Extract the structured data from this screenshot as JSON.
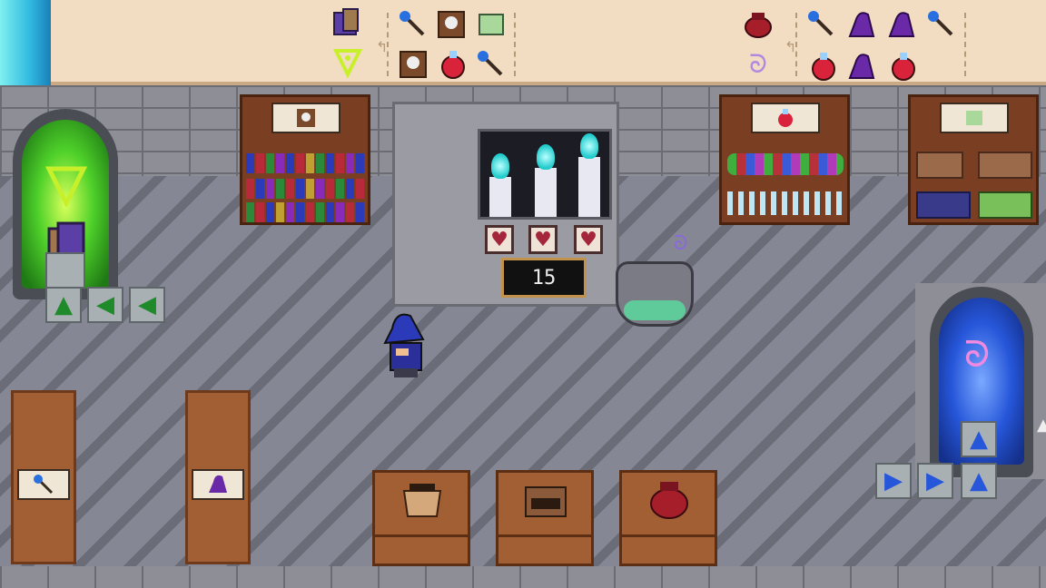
{
  "hud": {
    "timer_value": "15"
  },
  "colors": {
    "topbar_bg": "#f2ddc2",
    "portal_green": "#4fd12a",
    "portal_blue": "#2656d9",
    "flame_cyan": "#7ff0f0",
    "wood": "#a35f34"
  },
  "recipes": [
    {
      "result_icon": "blue-cube-icon",
      "result_mark": "green-triangle-rune-icon",
      "ingredients": [
        "blue-wand-icon",
        "skull-book-icon",
        "green-scroll-icon",
        "skull-book-icon",
        "red-potion-icon",
        "blue-wand-icon"
      ]
    },
    {
      "result_icon": "red-bag-icon",
      "result_mark": "purple-swirl-rune-icon",
      "ingredients": [
        "blue-wand-icon",
        "purple-hat-icon",
        "purple-hat-icon",
        "blue-wand-icon",
        "red-potion-icon",
        "purple-hat-icon",
        "red-potion-icon"
      ]
    }
  ],
  "shelves": [
    {
      "name": "bookshelf",
      "plaque_icon": "skull-book-icon"
    },
    {
      "name": "potion-shelf",
      "plaque_icon": "red-potion-icon"
    },
    {
      "name": "scroll-shelf",
      "plaque_icon": "green-scroll-icon"
    }
  ],
  "dispensers": [
    {
      "name": "wand-dispenser",
      "icon": "blue-wand-icon"
    },
    {
      "name": "hat-dispenser",
      "icon": "purple-hat-icon"
    }
  ],
  "crafting_stations": [
    {
      "name": "box-station",
      "icon": "open-box-icon"
    },
    {
      "name": "chest-station",
      "icon": "chest-icon"
    },
    {
      "name": "bag-station",
      "icon": "red-bag-icon"
    }
  ],
  "portals": [
    {
      "name": "green-portal",
      "rune": "triangle",
      "held_item": "blue-cube-icon"
    },
    {
      "name": "blue-portal",
      "rune": "swirl"
    }
  ]
}
